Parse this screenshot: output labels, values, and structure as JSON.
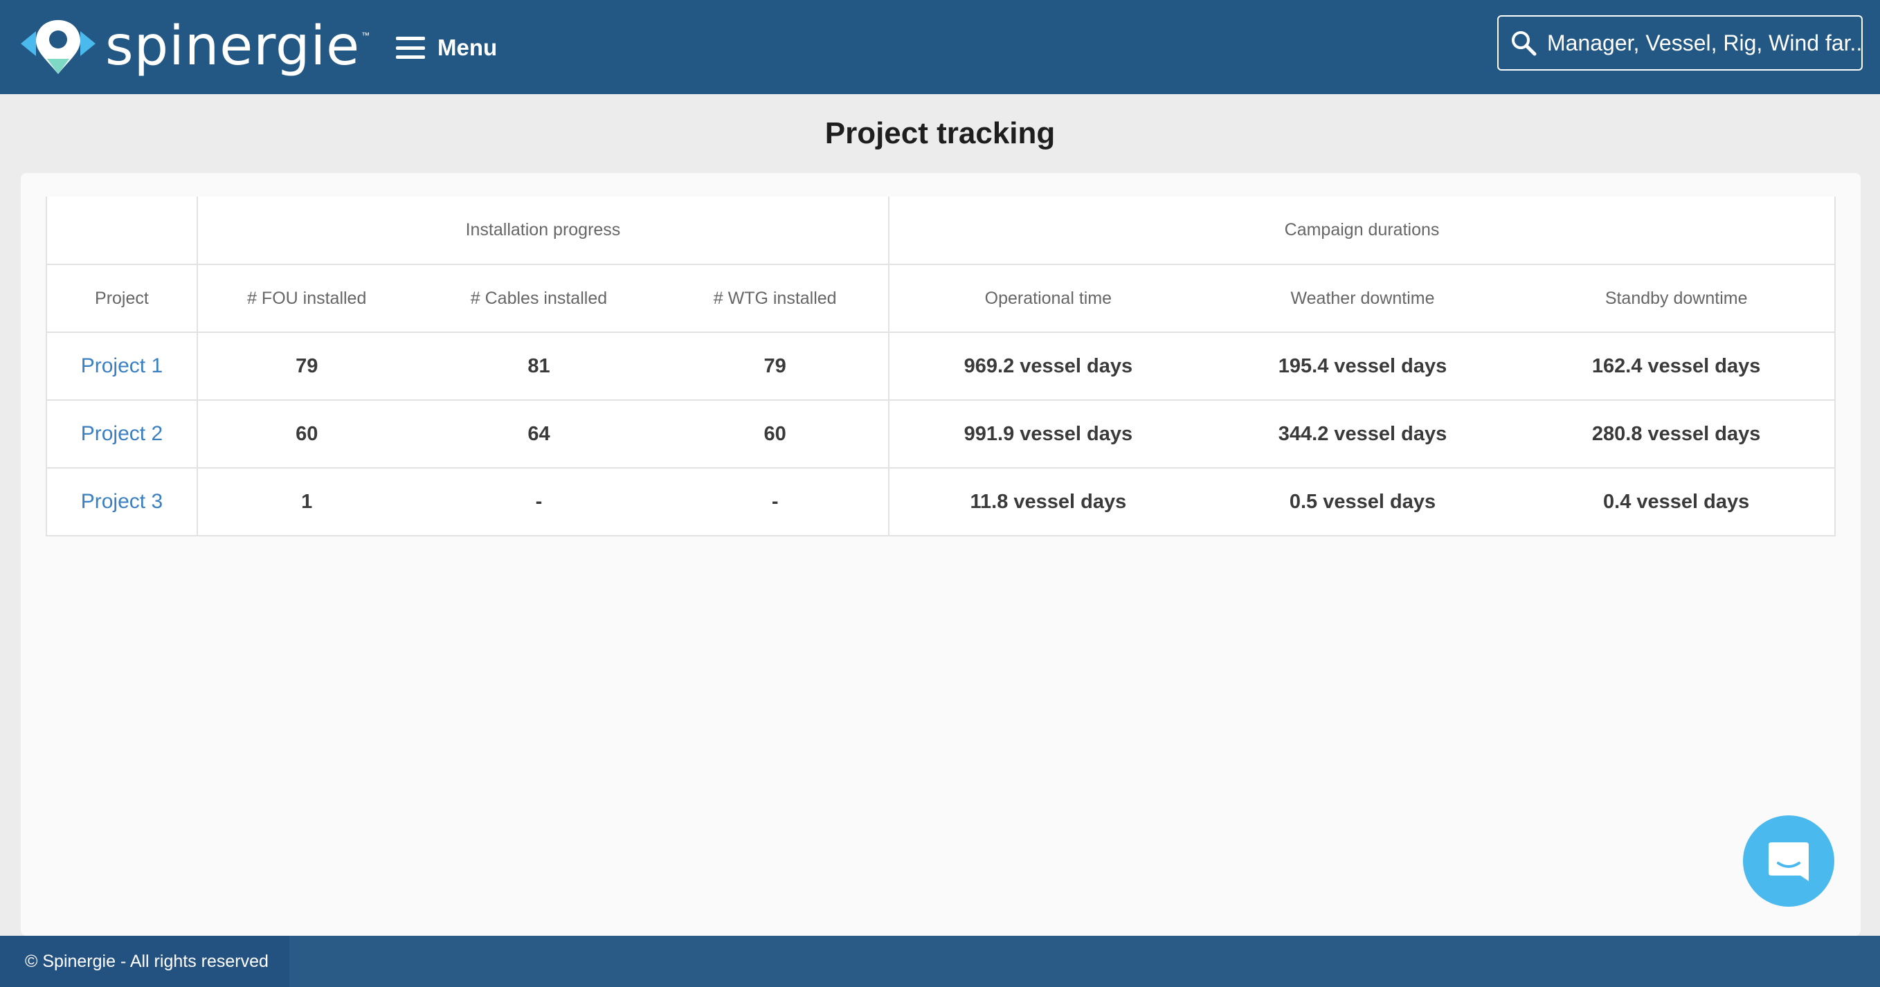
{
  "header": {
    "logo_text": "spinergie",
    "logo_tm": "™",
    "menu_label": "Menu",
    "search_placeholder": "Manager, Vessel, Rig, Wind far..."
  },
  "page": {
    "title": "Project tracking"
  },
  "table": {
    "groups": [
      "Installation progress",
      "Campaign durations"
    ],
    "columns": [
      "Project",
      "# FOU installed",
      "# Cables installed",
      "# WTG installed",
      "Operational time",
      "Weather downtime",
      "Standby downtime"
    ],
    "rows": [
      {
        "project": "Project 1",
        "fou": "79",
        "cables": "81",
        "wtg": "79",
        "operational": "969.2 vessel days",
        "weather": "195.4 vessel days",
        "standby": "162.4 vessel days"
      },
      {
        "project": "Project 2",
        "fou": "60",
        "cables": "64",
        "wtg": "60",
        "operational": "991.9 vessel days",
        "weather": "344.2 vessel days",
        "standby": "280.8 vessel days"
      },
      {
        "project": "Project 3",
        "fou": "1",
        "cables": "-",
        "wtg": "-",
        "operational": "11.8 vessel days",
        "weather": "0.5 vessel days",
        "standby": "0.4 vessel days"
      }
    ]
  },
  "footer": {
    "copyright": "© Spinergie - All rights reserved"
  },
  "colors": {
    "header_bg": "#235784",
    "link": "#3a7fc2",
    "chat": "#4ab9ee"
  },
  "icons": {
    "logo": "spinergie-logo-icon",
    "menu": "hamburger-icon",
    "search": "search-icon",
    "chat": "chat-icon"
  }
}
